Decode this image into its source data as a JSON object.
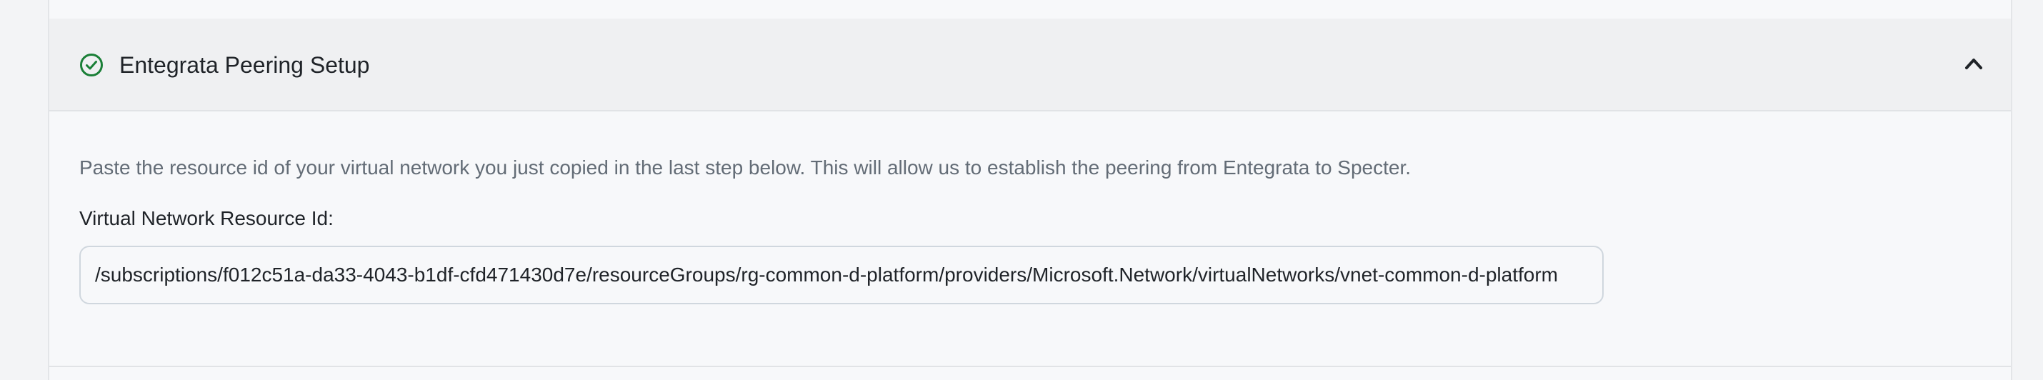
{
  "section": {
    "title": "Entegrata Peering Setup",
    "status_icon": "check-circle-icon",
    "toggle_icon": "chevron-up-icon",
    "status_color": "#1a7f37",
    "expanded": true
  },
  "body": {
    "description": "Paste the resource id of your virtual network you just copied in the last step below. This will allow us to establish the peering from Entegrata to Specter.",
    "field_label": "Virtual Network Resource Id:",
    "field_value": "/subscriptions/f012c51a-da33-4043-b1df-cfd471430d7e/resourceGroups/rg-common-d-platform/providers/Microsoft.Network/virtualNetworks/vnet-common-d-platform"
  }
}
